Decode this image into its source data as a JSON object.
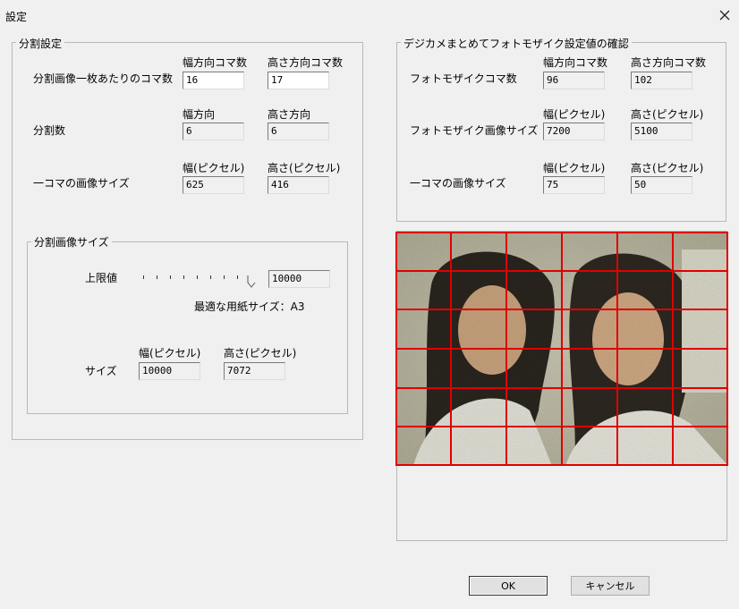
{
  "window": {
    "title": "設定",
    "close_icon": "close-icon"
  },
  "split_settings": {
    "legend": "分割設定",
    "col_header_width_count": "幅方向コマ数",
    "col_header_height_count": "高さ方向コマ数",
    "row_per_image_label": "分割画像一枚あたりのコマ数",
    "width_count_value": "16",
    "height_count_value": "17",
    "col_header_width_dir": "幅方向",
    "col_header_height_dir": "高さ方向",
    "row_split_label": "分割数",
    "split_width_value": "6",
    "split_height_value": "6",
    "col_header_width_px": "幅(ピクセル)",
    "col_header_height_px": "高さ(ピクセル)",
    "row_cell_size_label": "一コマの画像サイズ",
    "cell_width_value": "625",
    "cell_height_value": "416"
  },
  "split_image_size": {
    "legend": "分割画像サイズ",
    "upper_limit_label": "上限値",
    "upper_limit_value": "10000",
    "paper_size_text": "最適な用紙サイズ：A3",
    "col_header_width_px": "幅(ピクセル)",
    "col_header_height_px": "高さ(ピクセル)",
    "size_label": "サイズ",
    "size_width_value": "10000",
    "size_height_value": "7072"
  },
  "confirm": {
    "legend": "デジカメまとめてフォトモザイク設定値の確認",
    "col_header_width_count": "幅方向コマ数",
    "col_header_height_count": "高さ方向コマ数",
    "row_mosaic_count_label": "フォトモザイクコマ数",
    "mosaic_width_count": "96",
    "mosaic_height_count": "102",
    "col_header_width_px": "幅(ピクセル)",
    "col_header_height_px": "高さ(ピクセル)",
    "row_mosaic_size_label": "フォトモザイク画像サイズ",
    "mosaic_width_px": "7200",
    "mosaic_height_px": "5100",
    "col_header_width_px2": "幅(ピクセル)",
    "col_header_height_px2": "高さ(ピクセル)",
    "row_cell_size_label": "一コマの画像サイズ",
    "cell_width_px": "75",
    "cell_height_px": "50"
  },
  "preview": {
    "grid_columns": 6,
    "grid_rows": 6,
    "grid_color": "#e00000"
  },
  "buttons": {
    "ok": "OK",
    "cancel": "キャンセル"
  }
}
